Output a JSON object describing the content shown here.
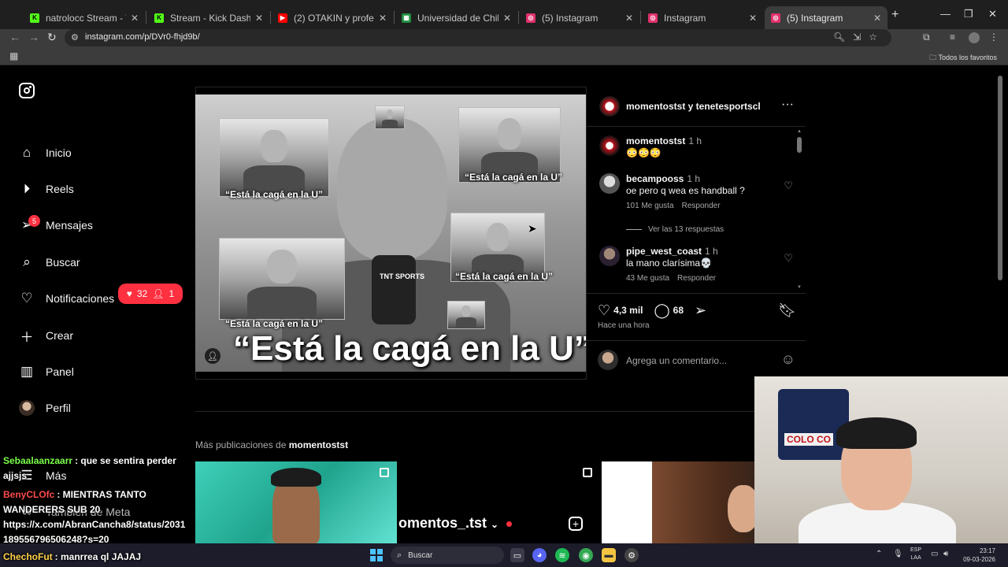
{
  "browser": {
    "tabs": [
      {
        "title": "natrolocc Stream - Watch Live",
        "favicon": "kick-icon",
        "color": "#53fc18",
        "active": false
      },
      {
        "title": "Stream - Kick Dashboard",
        "favicon": "kick-icon",
        "color": "#53fc18",
        "active": false
      },
      {
        "title": "(2) OTAKIN y profesor Klocker",
        "favicon": "youtube-icon",
        "color": "#ff0000",
        "active": false
      },
      {
        "title": "Universidad de Chile vs Univer",
        "favicon": "sheet-icon",
        "color": "#1e8e3e",
        "active": false
      },
      {
        "title": "(5) Instagram",
        "favicon": "instagram-icon",
        "color": "#e1306c",
        "active": false
      },
      {
        "title": "Instagram",
        "favicon": "instagram-icon",
        "color": "#e1306c",
        "active": false
      },
      {
        "title": "(5) Instagram",
        "favicon": "instagram-icon",
        "color": "#e1306c",
        "active": true
      }
    ],
    "url": "instagram.com/p/DVr0-fhjd9b/",
    "bookmarks_folder": "Todos los favoritos"
  },
  "sidebar": {
    "items": [
      {
        "label": "Inicio",
        "icon": "home-icon"
      },
      {
        "label": "Reels",
        "icon": "reels-icon"
      },
      {
        "label": "Mensajes",
        "icon": "messages-icon",
        "badge": "5"
      },
      {
        "label": "Buscar",
        "icon": "search-icon"
      },
      {
        "label": "Notificaciones",
        "icon": "heart-icon"
      },
      {
        "label": "Crear",
        "icon": "plus-icon"
      },
      {
        "label": "Panel",
        "icon": "dashboard-icon"
      },
      {
        "label": "Perfil",
        "icon": "avatar"
      },
      {
        "label": "Más",
        "icon": "menu-icon"
      },
      {
        "label": "También de Meta",
        "icon": "meta-icon"
      }
    ],
    "notifications_pill": {
      "likes": "32",
      "follows": "1"
    }
  },
  "post": {
    "header": "momentostst y tenetesportscl",
    "image_captions": {
      "main": "“Está la cagá en la U”",
      "small": "“Está la cagá en la U”"
    },
    "caption": {
      "user": "momentostst",
      "time": "1 h",
      "text": "😳😳😳"
    },
    "comments": [
      {
        "user": "becampooss",
        "time": "1 h",
        "text": "oe pero q wea es handball ?",
        "likes": "101 Me gusta",
        "reply": "Responder"
      },
      {
        "user": "pipe_west_coast",
        "time": "1 h",
        "text": "la mano clarísima💀",
        "likes": "43 Me gusta",
        "reply": "Responder"
      }
    ],
    "view_replies": "Ver las 13 respuestas",
    "like_count": "4,3 mil",
    "comment_count": "68",
    "time_ago": "Hace una hora",
    "comment_placeholder": "Agrega un comentario..."
  },
  "more_posts": {
    "prefix": "Más publicaciones de",
    "user": "momentostst",
    "thumb2_text": "omentos_.tst"
  },
  "chat": [
    {
      "user": "Sebaalaanzaarr",
      "user_color": "#7cff4a",
      "text": ": que se sentira perder"
    },
    {
      "user": "",
      "user_color": "#ffffff",
      "text": "ajjsjs"
    },
    {
      "user": "BenyCLOfc",
      "user_color": "#ff4a4a",
      "text": ": MIENTRAS TANTO"
    },
    {
      "user": "",
      "user_color": "#ffffff",
      "text": "WANDERERS SUB 20"
    },
    {
      "user": "",
      "user_color": "#ffffff",
      "text": "https://x.com/AbranCancha8/status/2031"
    },
    {
      "user": "",
      "user_color": "#ffffff",
      "text": "189556796506248?s=20"
    },
    {
      "user": "ChechoFut",
      "user_color": "#ffd24a",
      "text": ": manrrea ql JAJAJ"
    }
  ],
  "webcam": {
    "poster_text": "COLO CO"
  },
  "taskbar": {
    "search_label": "Buscar",
    "lang_top": "ESP",
    "lang_bottom": "LAA",
    "time": "23:17",
    "date": "09-03-2026"
  }
}
